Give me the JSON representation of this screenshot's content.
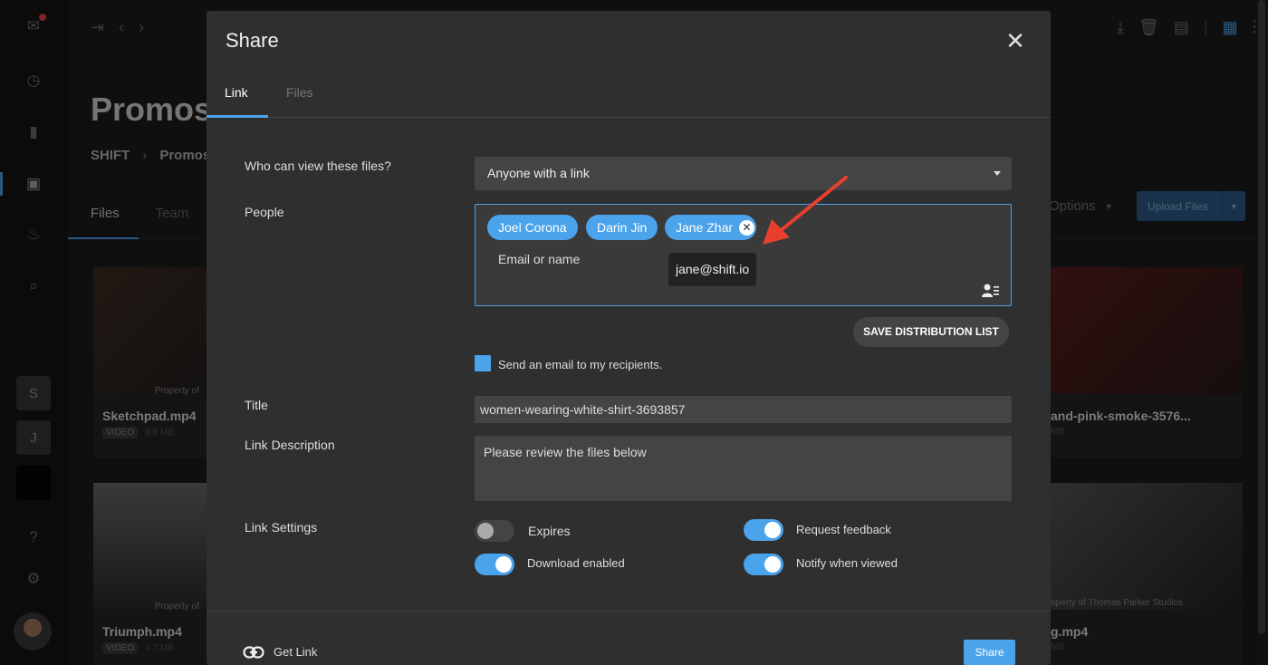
{
  "background": {
    "page_title": "Promos",
    "breadcrumb": [
      "SHIFT",
      "Promos"
    ],
    "tabs": [
      "Files",
      "Team"
    ],
    "options_label": "Options",
    "upload_label": "Upload Files",
    "workspace_letters": [
      "S",
      "J"
    ],
    "cards_left": [
      {
        "name": "Sketchpad.mp4",
        "badge": "VIDEO",
        "size": "8.8 MB",
        "prop": "Property of"
      },
      {
        "name": "Triumph.mp4",
        "badge": "VIDEO",
        "size": "4.7 MB",
        "prop": "Property of"
      }
    ],
    "cards_right": [
      {
        "name": "and-pink-smoke-3576...",
        "size": "MB",
        "prop": ""
      },
      {
        "name": "g.mp4",
        "size": "MB",
        "prop": "operty of Thomas Parker Studios"
      }
    ]
  },
  "modal": {
    "title": "Share",
    "tabs": {
      "link": "Link",
      "files": "Files"
    },
    "who_label": "Who can view these files?",
    "who_value": "Anyone with a link",
    "people_label": "People",
    "chips": [
      "Joel Corona",
      "Darin Jin",
      "Jane Zhar"
    ],
    "people_placeholder": "Email or name",
    "tooltip": "jane@shift.io",
    "save_dist": "SAVE DISTRIBUTION LIST",
    "send_email_label": "Send an email to my recipients.",
    "title_label": "Title",
    "title_value": "women-wearing-white-shirt-3693857",
    "desc_label": "Link Description",
    "desc_value": "Please review the files below",
    "settings_label": "Link Settings",
    "settings": {
      "expires": {
        "label": "Expires",
        "on": false
      },
      "download": {
        "label": "Download enabled",
        "on": true
      },
      "feedback": {
        "label": "Request feedback",
        "on": true
      },
      "notify": {
        "label": "Notify when viewed",
        "on": true
      }
    },
    "get_link": "Get Link",
    "share_button": "Share"
  },
  "colors": {
    "accent": "#4ba3ec",
    "arrow": "#e8402f"
  }
}
